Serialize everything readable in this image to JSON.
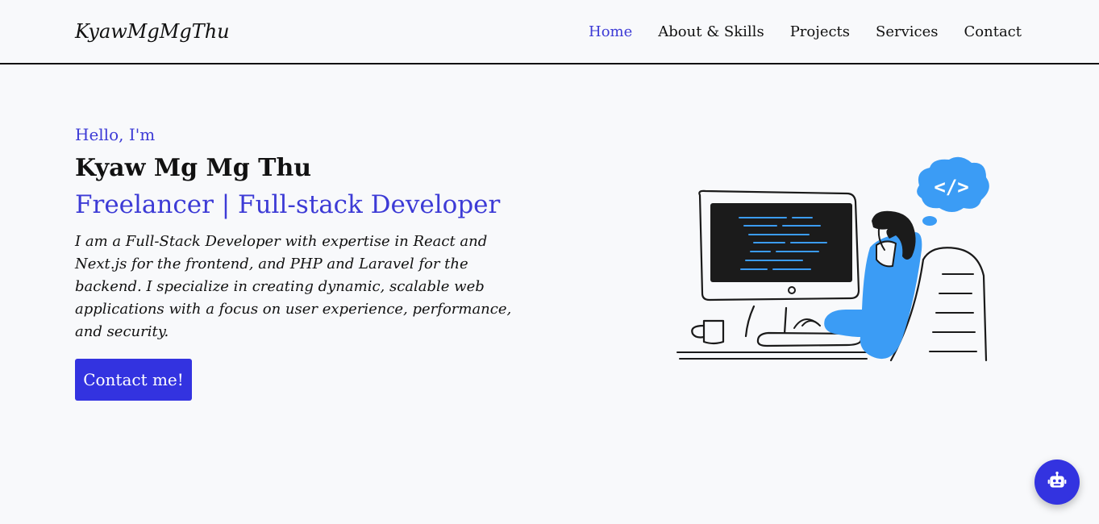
{
  "header": {
    "brand": "KyawMgMgThu",
    "nav": [
      {
        "label": "Home",
        "active": true
      },
      {
        "label": "About & Skills",
        "active": false
      },
      {
        "label": "Projects",
        "active": false
      },
      {
        "label": "Services",
        "active": false
      },
      {
        "label": "Contact",
        "active": false
      }
    ]
  },
  "hero": {
    "greeting": "Hello, I'm",
    "name": "Kyaw Mg Mg Thu",
    "role": "Freelancer | Full-stack Developer",
    "description": "I am a Full-Stack Developer with expertise in React and Next.js for the frontend, and PHP and Laravel for the backend. I specialize in creating dynamic, scalable web applications with a focus on user experience, performance, and security.",
    "cta_label": "Contact me!",
    "illustration_icon": "developer-at-computer-illustration",
    "thought_bubble_text": "</>"
  },
  "chat_widget": {
    "icon": "robot-icon"
  },
  "colors": {
    "accent": "#3d3bd6",
    "button": "#3333e0",
    "illustration_blue": "#3b9cf5",
    "background": "#f8f9fb",
    "text": "#111111"
  }
}
